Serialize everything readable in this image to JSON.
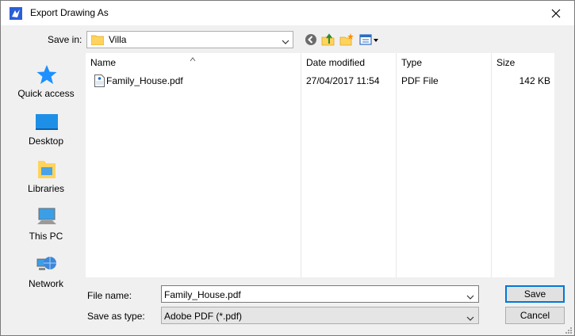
{
  "window": {
    "title": "Export Drawing As",
    "close_icon": "close-icon"
  },
  "savein": {
    "label": "Save in:",
    "value": "Villa"
  },
  "toolbar": {
    "back_icon": "back-icon",
    "up_icon": "up-folder-icon",
    "new_folder_icon": "new-folder-icon",
    "view_icon": "view-menu-icon"
  },
  "places": [
    {
      "label": "Quick access",
      "icon": "star-icon"
    },
    {
      "label": "Desktop",
      "icon": "desktop-icon"
    },
    {
      "label": "Libraries",
      "icon": "libraries-icon"
    },
    {
      "label": "This PC",
      "icon": "computer-icon"
    },
    {
      "label": "Network",
      "icon": "network-icon"
    }
  ],
  "filelist": {
    "columns": [
      "Name",
      "Date modified",
      "Type",
      "Size"
    ],
    "rows": [
      {
        "name": "Family_House.pdf",
        "date": "27/04/2017 11:54",
        "type": "PDF File",
        "size": "142 KB"
      }
    ]
  },
  "filename": {
    "label": "File name:",
    "value": "Family_House.pdf"
  },
  "savetype": {
    "label": "Save as type:",
    "value": "Adobe PDF (*.pdf)"
  },
  "buttons": {
    "save": "Save",
    "cancel": "Cancel"
  },
  "colors": {
    "accent": "#0078d7",
    "star": "#1e90ff",
    "folder": "#ffd35c"
  }
}
